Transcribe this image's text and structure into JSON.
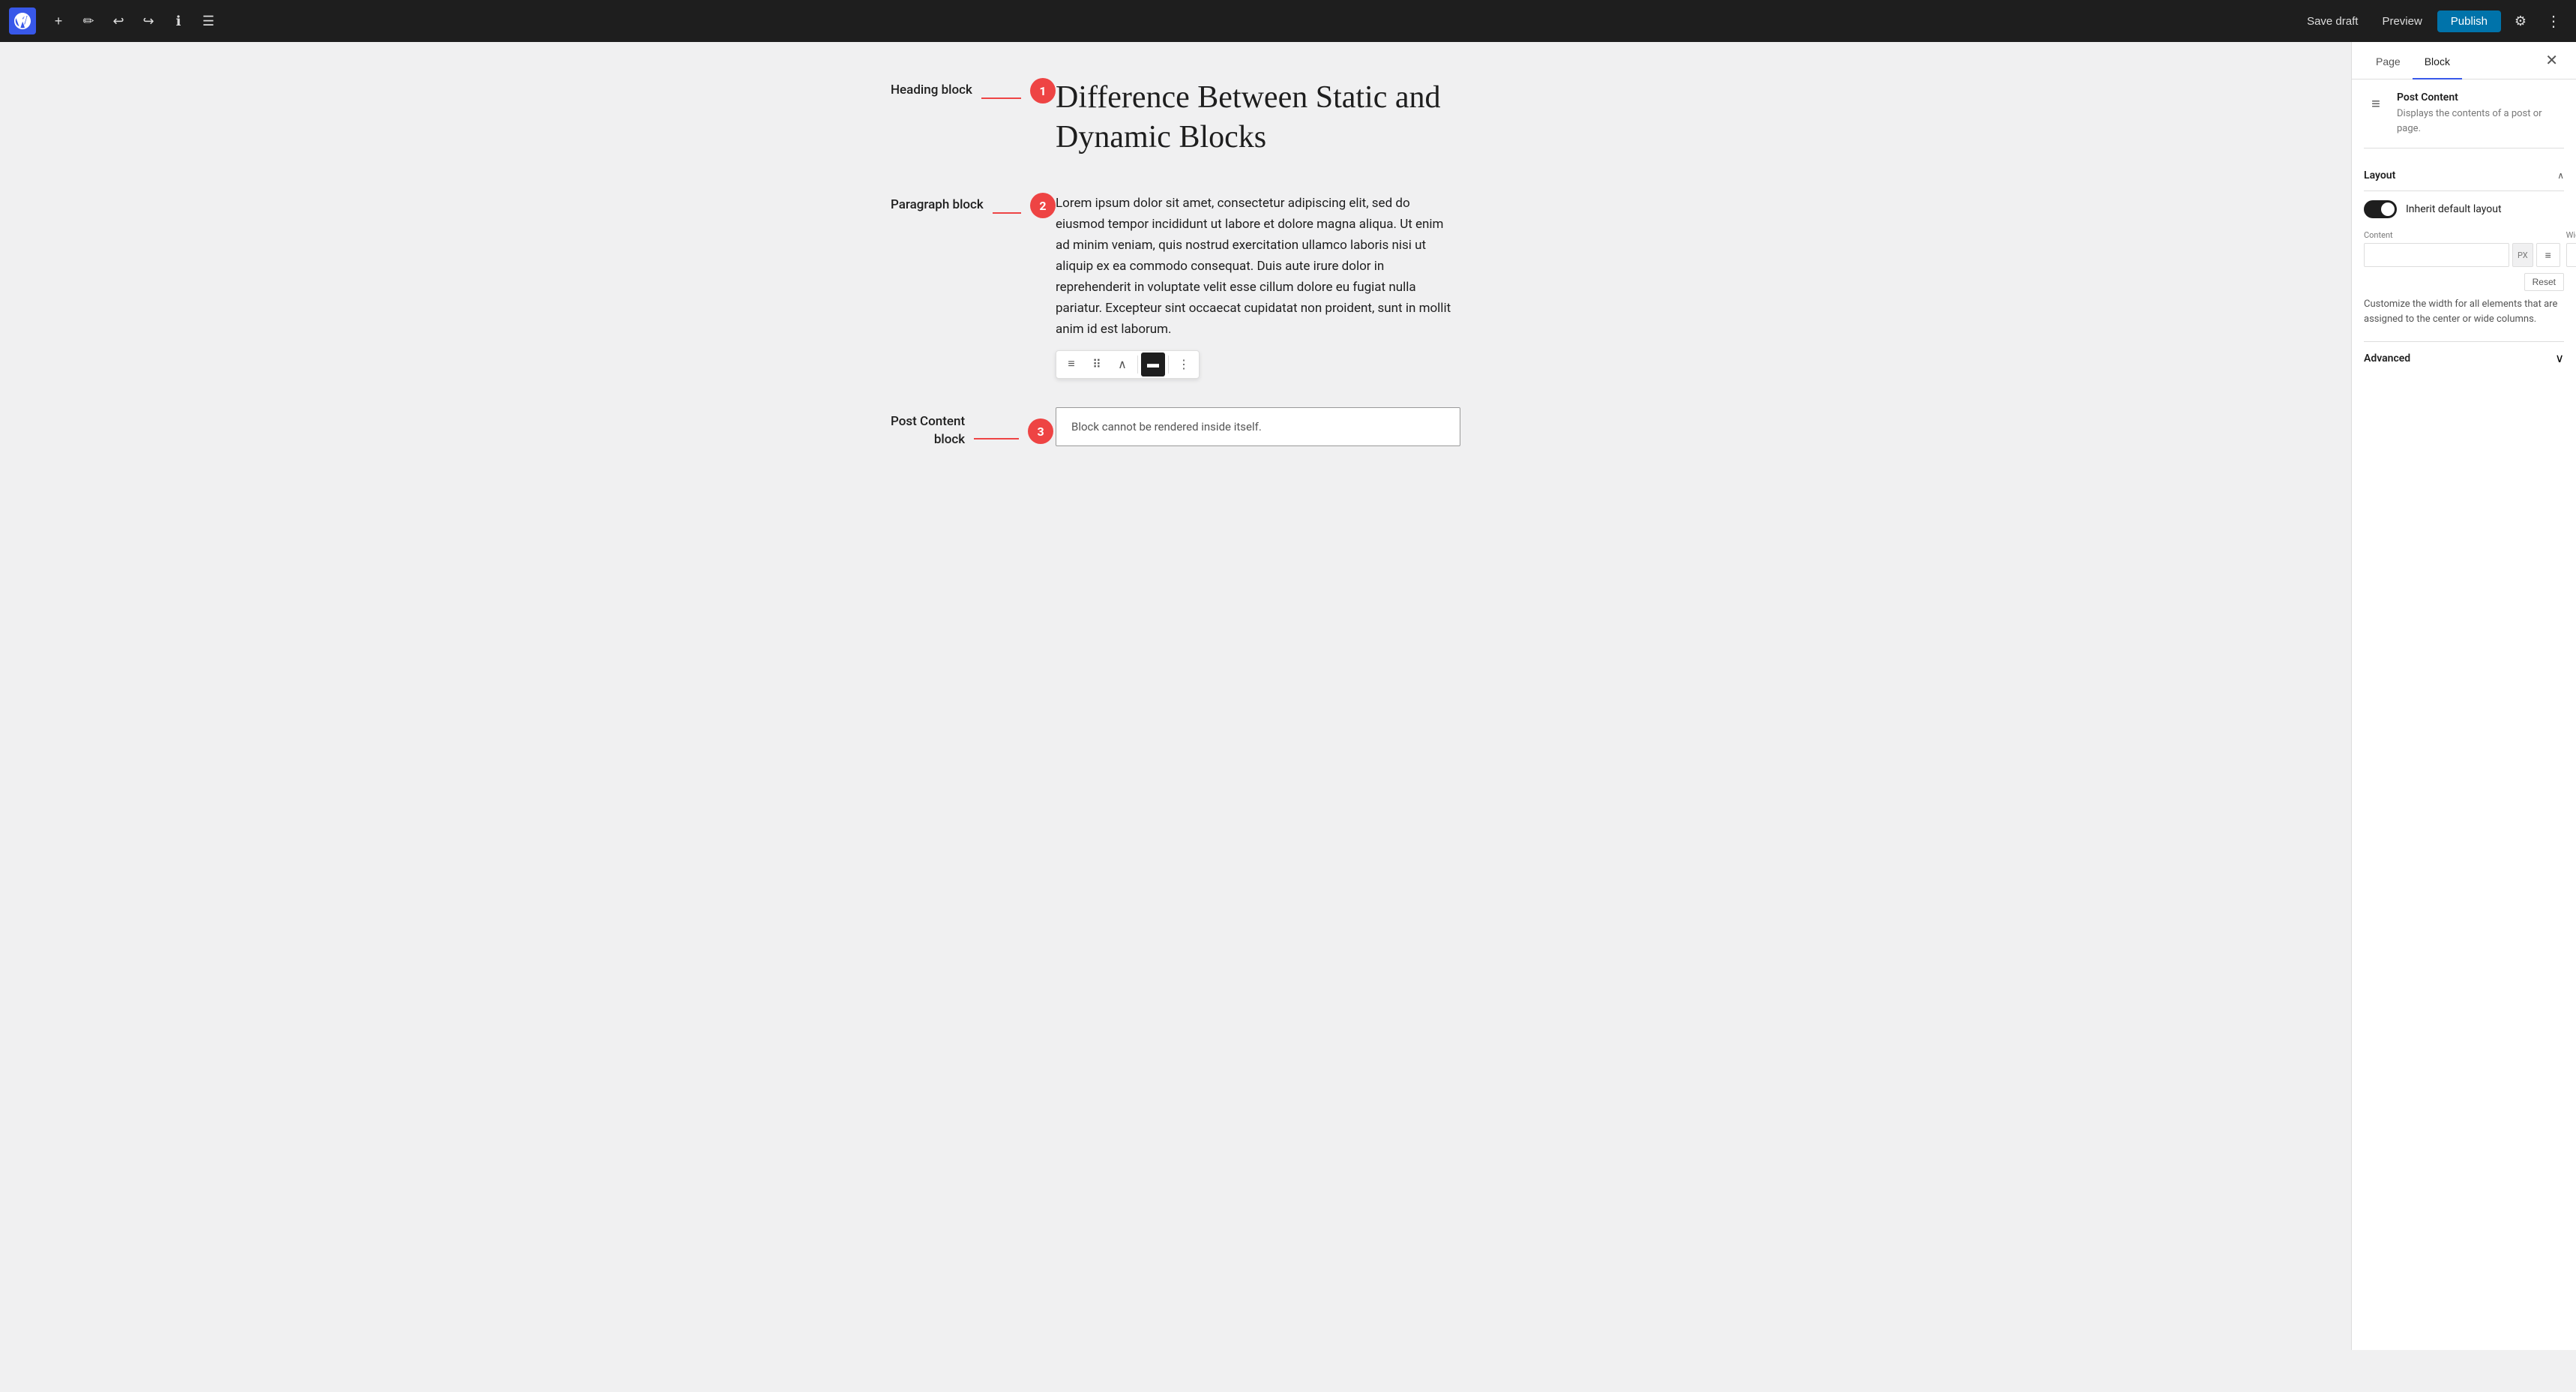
{
  "toolbar": {
    "add_label": "+",
    "undo_label": "↩",
    "redo_label": "↪",
    "info_label": "ℹ",
    "list_label": "☰",
    "save_draft_label": "Save draft",
    "preview_label": "Preview",
    "publish_label": "Publish",
    "settings_label": "⚙",
    "more_label": "⋮"
  },
  "editor": {
    "heading_block_label": "Heading block",
    "paragraph_block_label": "Paragraph block",
    "post_content_block_label": "Post Content\nblock",
    "heading_text": "Difference Between Static and Dynamic Blocks",
    "paragraph_text": "Lorem ipsum dolor sit amet, consectetur adipiscing elit, sed do eiusmod tempor incididunt ut labore et dolore magna aliqua. Ut enim ad minim veniam, quis nostrud exercitation ullamco laboris nisi ut aliquip ex ea commodo consequat. Duis aute irure dolor in reprehenderit in voluptate velit esse cillum dolore eu fugiat nulla pariatur. Excepteur sint occaecat cupidatat non proident, sunt in mollit anim id est laborum.",
    "post_content_message": "Block cannot be rendered inside itself.",
    "annotation_1": "1",
    "annotation_2": "2",
    "annotation_3": "3"
  },
  "sidebar": {
    "tab_page_label": "Page",
    "tab_block_label": "Block",
    "close_label": "✕",
    "block_icon": "≡",
    "block_title": "Post Content",
    "block_description": "Displays the contents of a post or page.",
    "layout_section_label": "Layout",
    "inherit_layout_label": "Inherit default layout",
    "content_label": "Content",
    "wide_label": "Wide",
    "px_label": "PX",
    "reset_label": "Reset",
    "customize_text": "Customize the width for all elements that are assigned to the center or wide columns.",
    "advanced_label": "Advanced",
    "chevron_up": "∧",
    "chevron_down": "∨"
  },
  "colors": {
    "accent_blue": "#3858e9",
    "publish_blue": "#0073aa",
    "annotation_red": "#e44",
    "toolbar_bg": "#1e1e1e"
  }
}
